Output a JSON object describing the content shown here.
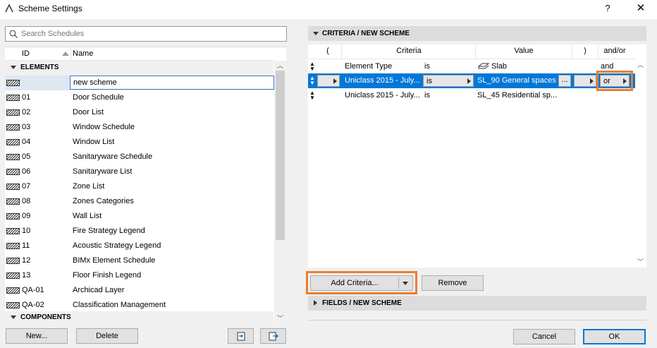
{
  "window": {
    "title": "Scheme Settings",
    "help": "?",
    "close": "✕"
  },
  "search": {
    "placeholder": "Search Schedules"
  },
  "list": {
    "col_id": "ID",
    "col_name": "Name",
    "group_elements": "ELEMENTS",
    "group_components": "COMPONENTS",
    "new_row_value": "new scheme",
    "rows": [
      {
        "id": "01",
        "name": "Door Schedule"
      },
      {
        "id": "02",
        "name": "Door List"
      },
      {
        "id": "03",
        "name": "Window Schedule"
      },
      {
        "id": "04",
        "name": "Window List"
      },
      {
        "id": "05",
        "name": "Sanitaryware Schedule"
      },
      {
        "id": "06",
        "name": "Sanitaryware List"
      },
      {
        "id": "07",
        "name": "Zone List"
      },
      {
        "id": "08",
        "name": "Zones Categories"
      },
      {
        "id": "09",
        "name": "Wall List"
      },
      {
        "id": "10",
        "name": "Fire Strategy Legend"
      },
      {
        "id": "11",
        "name": "Acoustic Strategy Legend"
      },
      {
        "id": "12",
        "name": "BIMx Element Schedule"
      },
      {
        "id": "13",
        "name": "Floor Finish Legend"
      },
      {
        "id": "QA-01",
        "name": "Archicad Layer"
      },
      {
        "id": "QA-02",
        "name": "Classification Management"
      }
    ]
  },
  "left_buttons": {
    "new": "New...",
    "delete": "Delete"
  },
  "criteria": {
    "section_title": "CRITERIA /  NEW SCHEME",
    "headers": {
      "open": "(",
      "criteria": "Criteria",
      "value": "Value",
      "close": ")",
      "andor": "and/or"
    },
    "rows": [
      {
        "criteria": "Element Type",
        "op": "is",
        "value": "Slab",
        "andor": "and"
      },
      {
        "criteria": "Uniclass 2015 - July...",
        "op": "is",
        "value": "SL_90 General spaces",
        "more": "...",
        "andor": "or"
      },
      {
        "criteria": "Uniclass 2015 - July...",
        "op": "is",
        "value": "SL_45 Residential sp...",
        "andor": ""
      }
    ],
    "add_button": "Add Criteria...",
    "remove_button": "Remove"
  },
  "fields": {
    "section_title": "FIELDS /  NEW SCHEME"
  },
  "dialog_buttons": {
    "cancel": "Cancel",
    "ok": "OK"
  },
  "colors": {
    "accent": "#0078d7",
    "highlight": "#ed7d31"
  }
}
